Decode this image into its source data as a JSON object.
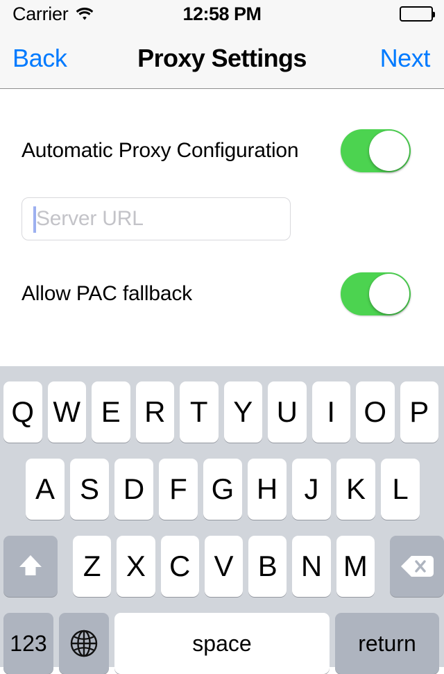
{
  "status_bar": {
    "carrier": "Carrier",
    "wifi_icon": "wifi-icon",
    "time": "12:58 PM",
    "battery_icon": "battery-full-icon",
    "battery_level_pct": 100
  },
  "nav_bar": {
    "back_label": "Back",
    "title": "Proxy Settings",
    "next_label": "Next",
    "tint_color": "#007aff"
  },
  "form": {
    "rows": [
      {
        "label": "Automatic Proxy Configuration",
        "control": "switch",
        "state": "on",
        "on_color": "#4cd350"
      },
      {
        "label": "Allow PAC fallback",
        "control": "switch",
        "state": "on",
        "on_color": "#4cd350"
      }
    ],
    "server_url_field": {
      "placeholder": "Server URL",
      "value": "",
      "focused": true,
      "caret_color": "#9db0f0"
    }
  },
  "keyboard": {
    "layout": "qwerty-uppercase",
    "background_color": "#d1d5db",
    "row1": [
      "Q",
      "W",
      "E",
      "R",
      "T",
      "Y",
      "U",
      "I",
      "O",
      "P"
    ],
    "row2": [
      "A",
      "S",
      "D",
      "F",
      "G",
      "H",
      "J",
      "K",
      "L"
    ],
    "row3_letters": [
      "Z",
      "X",
      "C",
      "V",
      "B",
      "N",
      "M"
    ],
    "shift_key": {
      "icon": "shift-arrow-icon",
      "label": ""
    },
    "delete_key": {
      "icon": "delete-backspace-icon",
      "label": ""
    },
    "numbers_key": {
      "label": "123"
    },
    "globe_key": {
      "icon": "globe-icon",
      "label": ""
    },
    "space_key": {
      "label": "space"
    },
    "return_key": {
      "label": "return"
    }
  }
}
